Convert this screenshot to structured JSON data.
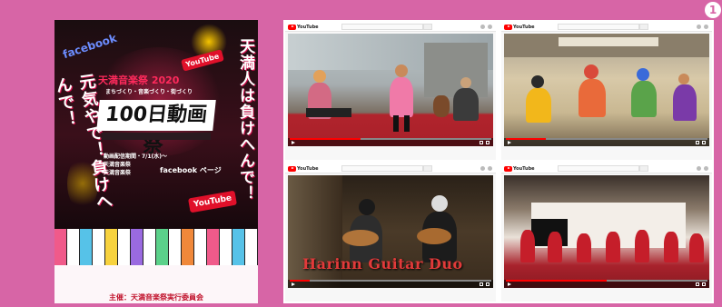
{
  "figure_number": "1",
  "poster": {
    "vertical_right": "天満人は負けへんで！",
    "vertical_left": "元気やで！負けへんで！",
    "facebook_label": "facebook",
    "youtube_label_top": "YouTube",
    "youtube_label_bottom": "YouTube",
    "festival_title": "天満音楽祭 2020",
    "festival_subtitle": "まちづくり・音楽づくり・街づくり",
    "main_title": "100日動画祭",
    "info_lines": [
      "動画配信期間・7/1(水)～",
      "天満音楽祭",
      "天満音楽祭"
    ],
    "facebook_page": "facebook ページ",
    "host": "主催：天満音楽祭実行委員会"
  },
  "videos": [
    {
      "site": "YouTube",
      "overlay_title": ""
    },
    {
      "site": "YouTube",
      "overlay_title": ""
    },
    {
      "site": "YouTube",
      "overlay_title": "Harinn Guitar Duo"
    },
    {
      "site": "YouTube",
      "overlay_title": ""
    }
  ],
  "colors": {
    "background": "#d765a6",
    "poster_accent": "#e0102a",
    "youtube_red": "#ff0000"
  }
}
